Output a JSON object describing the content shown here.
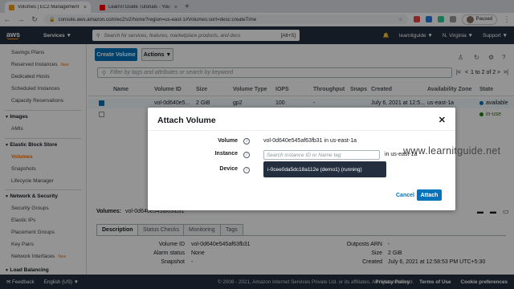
{
  "browser": {
    "tabs": [
      {
        "title": "Volumes | EC2 Management Co",
        "active": true,
        "favicon_color": "#ff9900"
      },
      {
        "title": "LearnITGuide Tutorials - YouTube",
        "active": false,
        "favicon_color": "#ff0000"
      }
    ],
    "new_tab": "+",
    "url": "console.aws.amazon.com/ec2/v2/home?region=us-east-1#Volumes:sort=desc:createTime",
    "profile_status": "Paused"
  },
  "aws_nav": {
    "logo": "aws",
    "services": "Services ▼",
    "search_placeholder": "Search for services, features, marketplace products, and docs",
    "search_shortcut": "[Alt+S]",
    "account": "learnitguide ▼",
    "region": "N. Virginia ▼",
    "support": "Support ▼"
  },
  "sidebar": {
    "top_items": [
      {
        "label": "Savings Plans"
      },
      {
        "label": "Reserved Instances",
        "badge": "New"
      },
      {
        "label": "Dedicated Hosts"
      },
      {
        "label": "Scheduled Instances"
      },
      {
        "label": "Capacity Reservations"
      }
    ],
    "images_header": "Images",
    "images_items": [
      "AMIs"
    ],
    "ebs_header": "Elastic Block Store",
    "ebs_items": [
      "Volumes",
      "Snapshots",
      "Lifecycle Manager"
    ],
    "network_header": "Network & Security",
    "network_items": [
      {
        "label": "Security Groups"
      },
      {
        "label": "Elastic IPs"
      },
      {
        "label": "Placement Groups"
      },
      {
        "label": "Key Pairs"
      },
      {
        "label": "Network Interfaces",
        "badge": "New"
      }
    ],
    "lb_header": "Load Balancing"
  },
  "toolbar": {
    "create_volume": "Create Volume",
    "actions": "Actions ▼",
    "filter_placeholder": "Filter by tags and attributes or search by keyword",
    "pagination": "1 to 2 of 2"
  },
  "table": {
    "columns": [
      "Name",
      "Volume ID",
      "Size",
      "Volume Type",
      "IOPS",
      "Throughput",
      "Snaps",
      "Created",
      "Availability Zone",
      "State"
    ],
    "rows": [
      {
        "name": "",
        "volume_id": "vol-0d640e5...",
        "size": "2 GiB",
        "type": "gp2",
        "iops": "100",
        "throughput": "-",
        "snapshot": "",
        "created": "July 6, 2021 at 12:5...",
        "az": "us-east-1a",
        "state": "available",
        "state_color": "#1d8102",
        "selected": true
      },
      {
        "name": "",
        "volume_id": "",
        "size": "",
        "type": "",
        "iops": "",
        "throughput": "",
        "snapshot": "",
        "created": "",
        "az": "",
        "state": "in-use",
        "state_color": "#1d8102",
        "selected": false
      }
    ]
  },
  "details": {
    "title": "Volumes:",
    "volume_id": "vol-0d640e545af63fb31",
    "tabs": [
      "Description",
      "Status Checks",
      "Monitoring",
      "Tags"
    ],
    "fields_left": [
      {
        "label": "Volume ID",
        "value": "vol-0d640e545af63fb31"
      },
      {
        "label": "Alarm status",
        "value": "None"
      },
      {
        "label": "Snapshot",
        "value": "-"
      }
    ],
    "fields_right": [
      {
        "label": "Outposts ARN",
        "value": "-"
      },
      {
        "label": "Size",
        "value": "2 GiB"
      },
      {
        "label": "Created",
        "value": "July 6, 2021 at 12:58:53 PM UTC+5:30"
      }
    ]
  },
  "modal": {
    "title": "Attach Volume",
    "close": "✕",
    "volume_label": "Volume",
    "volume_value": "vol-0d640e545af63fb31 in us-east-1a",
    "instance_label": "Instance",
    "instance_placeholder": "Search instance ID or Name tag",
    "instance_zone": "in us-east-1a",
    "device_label": "Device",
    "dropdown_option": "i-0cee0da5dc18a112e (demo1) (running)",
    "cancel": "Cancel",
    "attach": "Attach"
  },
  "watermark": "www.learnitguide.net",
  "footer": {
    "feedback": "Feedback",
    "language": "English (US) ▼",
    "copyright": "© 2008 - 2021, Amazon Internet Services Private Ltd. or its affiliates. All rights reserved.",
    "links": [
      "Privacy Policy",
      "Terms of Use",
      "Cookie preferences"
    ]
  }
}
